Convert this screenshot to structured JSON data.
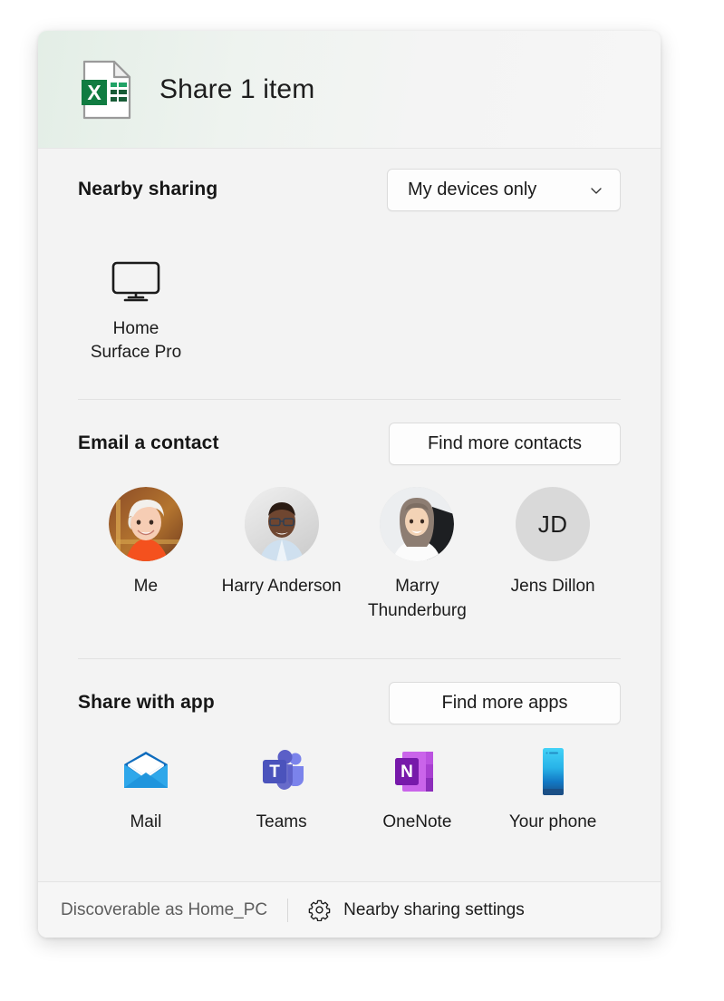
{
  "header": {
    "title": "Share 1 item",
    "file_icon": "excel-document-icon"
  },
  "nearby": {
    "title": "Nearby sharing",
    "scope_value": "My devices only",
    "scope_icon": "chevron-down-icon",
    "devices": [
      {
        "name": "Home Surface Pro",
        "icon": "monitor-icon"
      }
    ]
  },
  "contacts": {
    "title": "Email a contact",
    "find_more_label": "Find more contacts",
    "items": [
      {
        "name": "Me",
        "avatar": "photo-blonde-woman",
        "initials": ""
      },
      {
        "name": "Harry Anderson",
        "avatar": "photo-man-glasses",
        "initials": ""
      },
      {
        "name": "Marry Thunderburg",
        "avatar": "photo-woman-hijab",
        "initials": ""
      },
      {
        "name": "Jens Dillon",
        "avatar": "initials",
        "initials": "JD"
      }
    ]
  },
  "apps": {
    "title": "Share with app",
    "find_more_label": "Find more apps",
    "items": [
      {
        "name": "Mail",
        "icon": "mail-icon"
      },
      {
        "name": "Teams",
        "icon": "teams-icon"
      },
      {
        "name": "OneNote",
        "icon": "onenote-icon"
      },
      {
        "name": "Your phone",
        "icon": "phone-icon"
      }
    ]
  },
  "footer": {
    "discoverable_text": "Discoverable as Home_PC",
    "settings_label": "Nearby sharing settings",
    "settings_icon": "gear-icon"
  },
  "colors": {
    "excel_green": "#107c41",
    "teams_purple": "#5b5fc7",
    "onenote_purple": "#7719aa",
    "mail_blue": "#0f78d4",
    "phone_cyan": "#32bdef",
    "dialog_bg": "#f3f3f3",
    "header_tint": "#e3eee6"
  }
}
